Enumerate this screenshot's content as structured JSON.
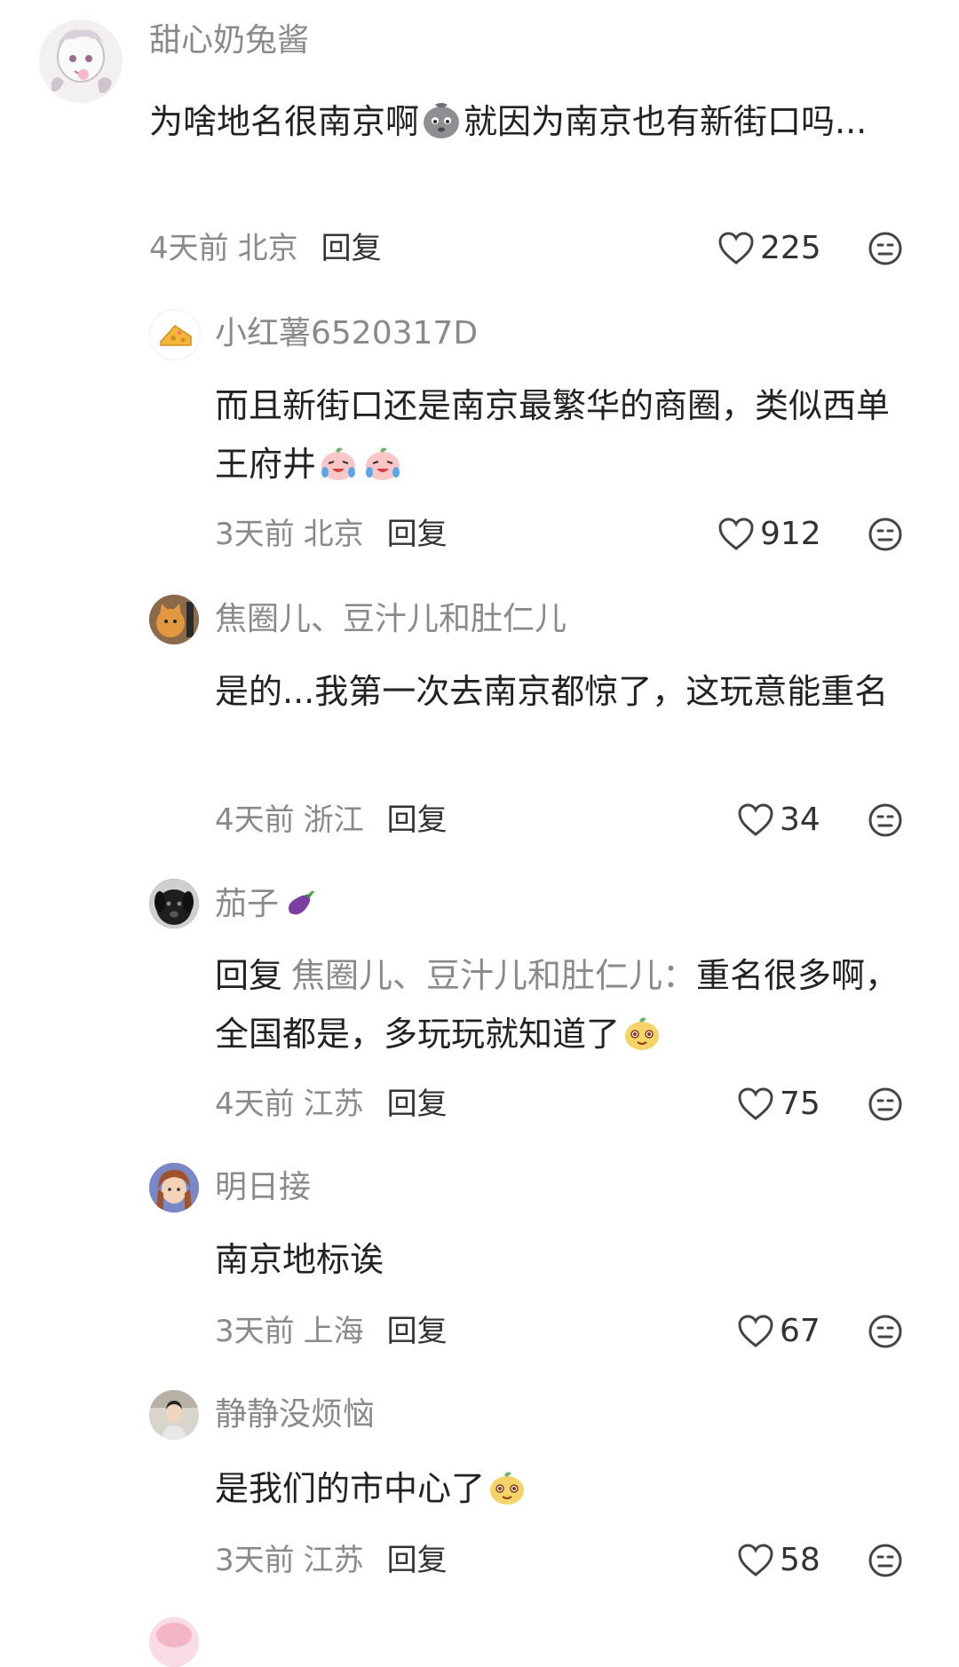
{
  "comments": [
    {
      "username": "甜心奶兔酱",
      "text_a": "为啥地名很南京啊",
      "text_b": "就因为南京也有新街口吗...",
      "time": "4天前",
      "location": "北京",
      "reply_label": "回复",
      "likes": "225",
      "emoji": "sigh-face"
    },
    {
      "username": "小红薯6520317D",
      "text_a": "而且新街口还是南京最繁华的商圈，类似西单王府井",
      "time": "3天前",
      "location": "北京",
      "reply_label": "回复",
      "likes": "912",
      "emoji": "crying-laughing-peach"
    },
    {
      "username": "焦圈儿、豆汁儿和肚仁儿",
      "text_a": "是的...我第一次去南京都惊了，这玩意能重名",
      "time": "4天前",
      "location": "浙江",
      "reply_label": "回复",
      "likes": "34"
    },
    {
      "username": "茄子",
      "username_emoji": "eggplant",
      "reply_prefix": "回复",
      "reply_target": "焦圈儿、豆汁儿和肚仁儿：",
      "text_a": "重名很多啊，全国都是，多玩玩就知道了",
      "time": "4天前",
      "location": "江苏",
      "reply_label": "回复",
      "likes": "75",
      "emoji": "smug-face"
    },
    {
      "username": "明日接",
      "text_a": "南京地标诶",
      "time": "3天前",
      "location": "上海",
      "reply_label": "回复",
      "likes": "67"
    },
    {
      "username": "静静没烦恼",
      "text_a": "是我们的市中心了",
      "time": "3天前",
      "location": "江苏",
      "reply_label": "回复",
      "likes": "58",
      "emoji": "smug-face"
    }
  ],
  "icons": {
    "like": "heart-outline-icon",
    "dislike": "neutral-face-icon"
  },
  "colors": {
    "text_primary": "#222222",
    "text_secondary": "#8a8a8a"
  }
}
